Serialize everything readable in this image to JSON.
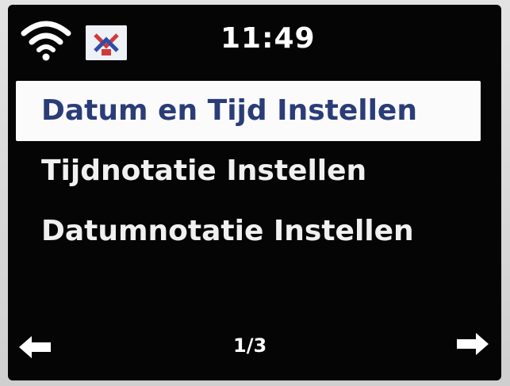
{
  "status": {
    "time": "11:49",
    "wifi_icon": "wifi-icon",
    "station_icon": "radio-station-logo-icon"
  },
  "menu": {
    "items": [
      {
        "label": "Datum en Tijd Instellen",
        "selected": true
      },
      {
        "label": "Tijdnotatie Instellen",
        "selected": false
      },
      {
        "label": "Datumnotatie Instellen",
        "selected": false
      }
    ]
  },
  "nav": {
    "page": "1/3",
    "prev_icon": "arrow-left-icon",
    "next_icon": "arrow-right-icon"
  },
  "colors": {
    "background": "#050505",
    "text": "#f2f2f2",
    "highlight": "#fbfbfb",
    "highlight_text": "#2a3d78"
  }
}
